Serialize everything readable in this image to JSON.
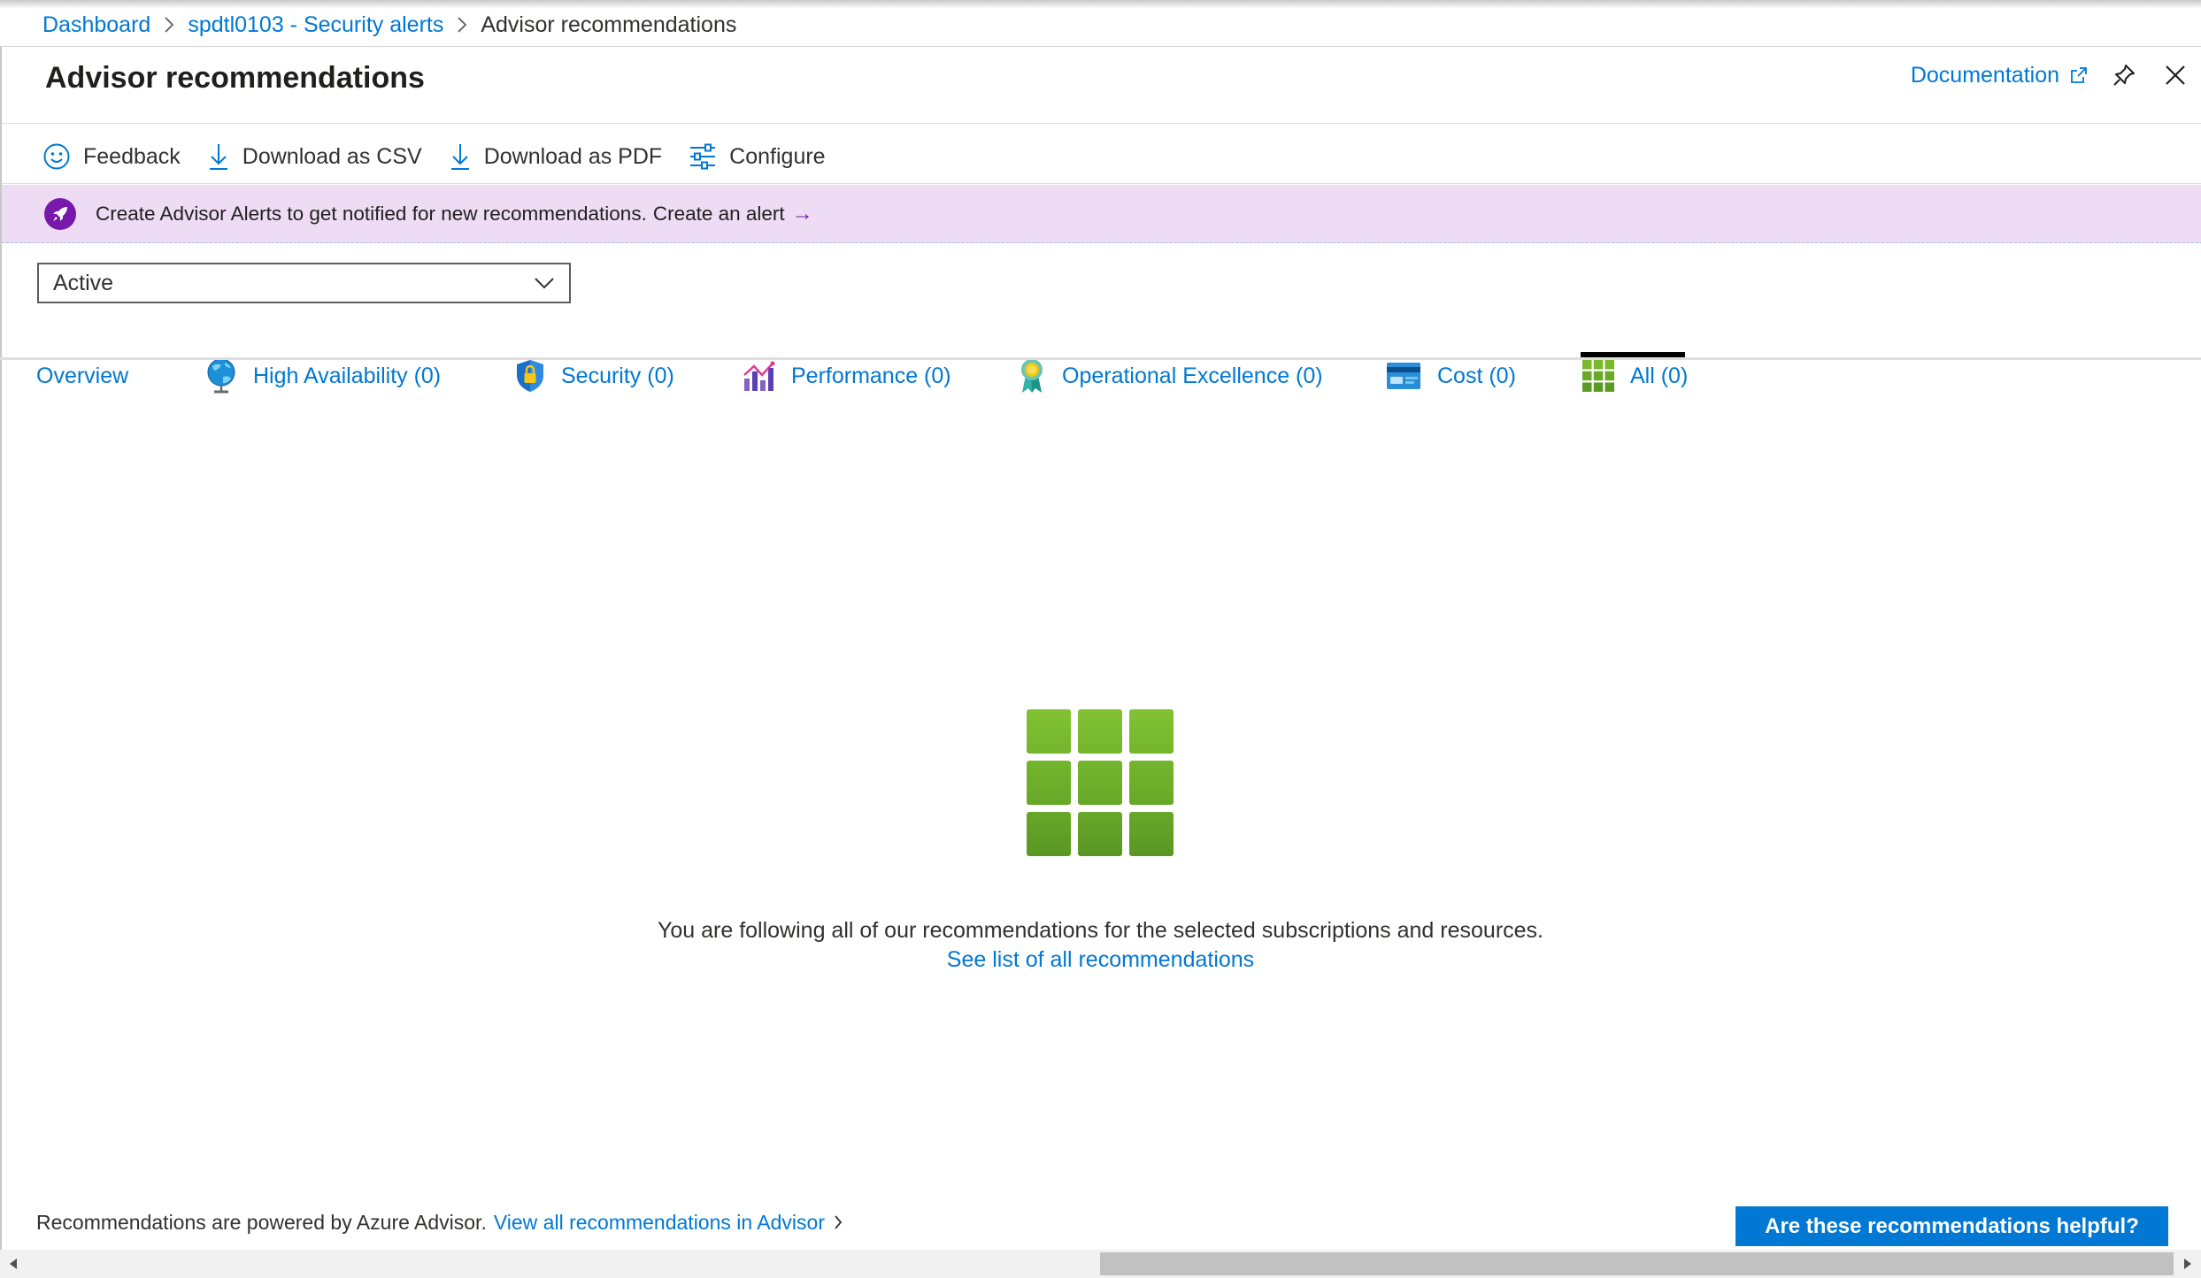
{
  "breadcrumb": {
    "items": [
      "Dashboard",
      "spdtl0103 - Security alerts"
    ],
    "current": "Advisor recommendations"
  },
  "blade": {
    "title": "Advisor recommendations",
    "documentation_label": "Documentation"
  },
  "toolbar": {
    "feedback": "Feedback",
    "download_csv": "Download as CSV",
    "download_pdf": "Download as PDF",
    "configure": "Configure"
  },
  "banner": {
    "text": "Create Advisor Alerts to get notified for new recommendations.",
    "link": "Create an alert",
    "arrow": "→",
    "background": "#eddcf3",
    "icon_color": "#7719aa"
  },
  "filter": {
    "selected": "Active"
  },
  "tabs": [
    {
      "label": "Overview",
      "icon": "none"
    },
    {
      "label": "High Availability (0)",
      "icon": "globe-icon"
    },
    {
      "label": "Security (0)",
      "icon": "shield-lock-icon"
    },
    {
      "label": "Performance (0)",
      "icon": "performance-chart-icon"
    },
    {
      "label": "Operational Excellence (0)",
      "icon": "award-ribbon-icon"
    },
    {
      "label": "Cost (0)",
      "icon": "credit-card-icon"
    },
    {
      "label": "All (0)",
      "icon": "grid-icon",
      "selected": true
    }
  ],
  "empty_state": {
    "icon": "green-grid-icon",
    "message": "You are following all of our recommendations for the selected subscriptions and resources.",
    "link": "See list of all recommendations"
  },
  "footer": {
    "text": "Recommendations are powered by Azure Advisor.",
    "link": "View all recommendations in Advisor",
    "helpful_button": "Are these recommendations helpful?"
  },
  "colors": {
    "accent": "#0078d4",
    "grid_green": "#6bb22c"
  }
}
